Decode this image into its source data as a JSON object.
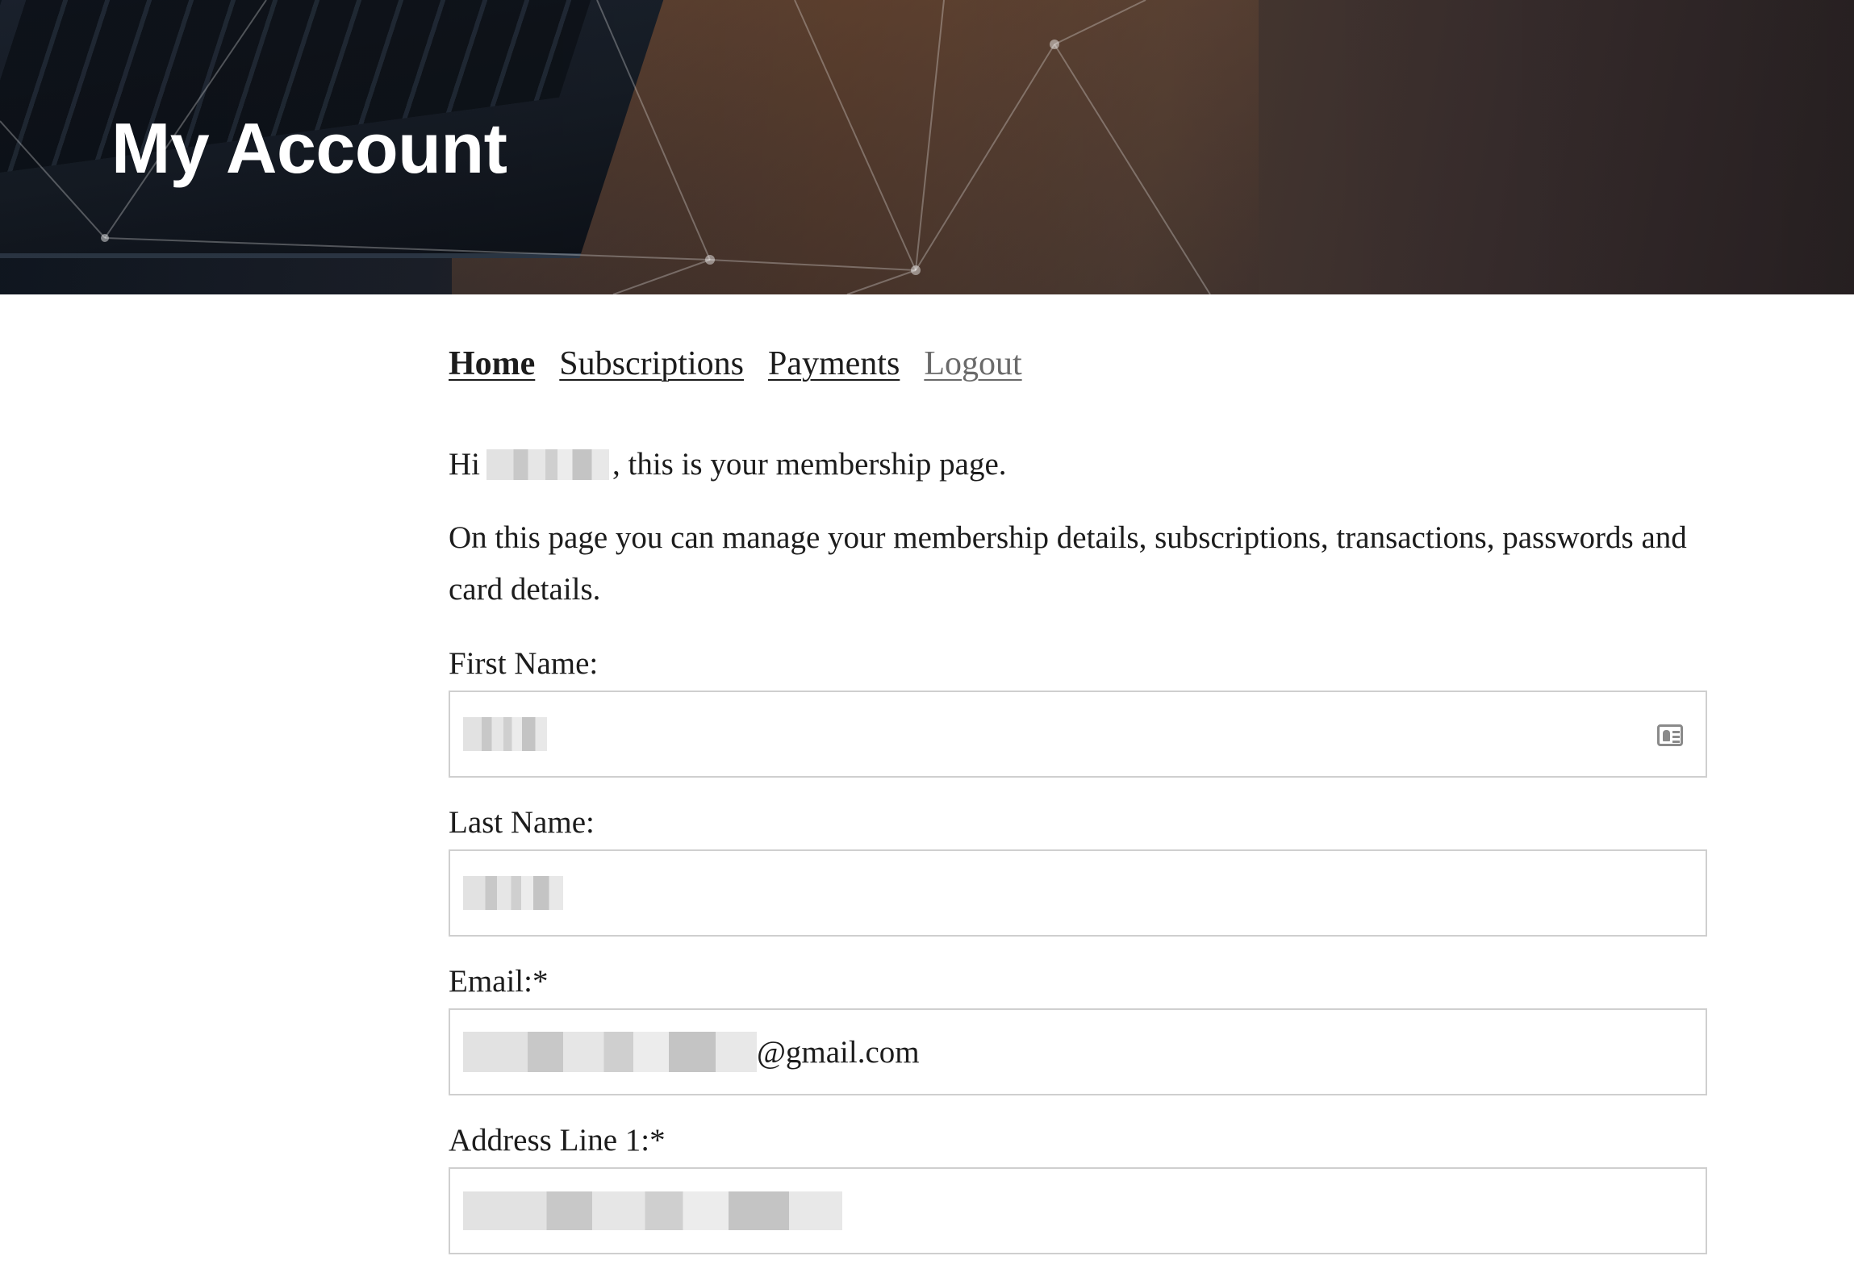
{
  "header": {
    "title": "My Account"
  },
  "nav": {
    "items": [
      {
        "label": "Home",
        "active": true
      },
      {
        "label": "Subscriptions",
        "active": false
      },
      {
        "label": "Payments",
        "active": false
      },
      {
        "label": "Logout",
        "active": false
      }
    ]
  },
  "greeting": {
    "prefix": "Hi",
    "suffix": ", this is your membership page."
  },
  "intro": {
    "text": "On this page you can manage your membership details, subscriptions, transactions, passwords and card details."
  },
  "form": {
    "first_name": {
      "label": "First Name:",
      "icon": "contact-card-icon"
    },
    "last_name": {
      "label": "Last Name:"
    },
    "email": {
      "label": "Email:*",
      "visible_value_suffix": "@gmail.com"
    },
    "address_line_1": {
      "label": "Address Line 1:*"
    }
  },
  "colors": {
    "text": "#1c1c1c",
    "logout_link": "#6a6a6a",
    "input_border": "#cfcfcf",
    "hero_title": "#ffffff"
  }
}
